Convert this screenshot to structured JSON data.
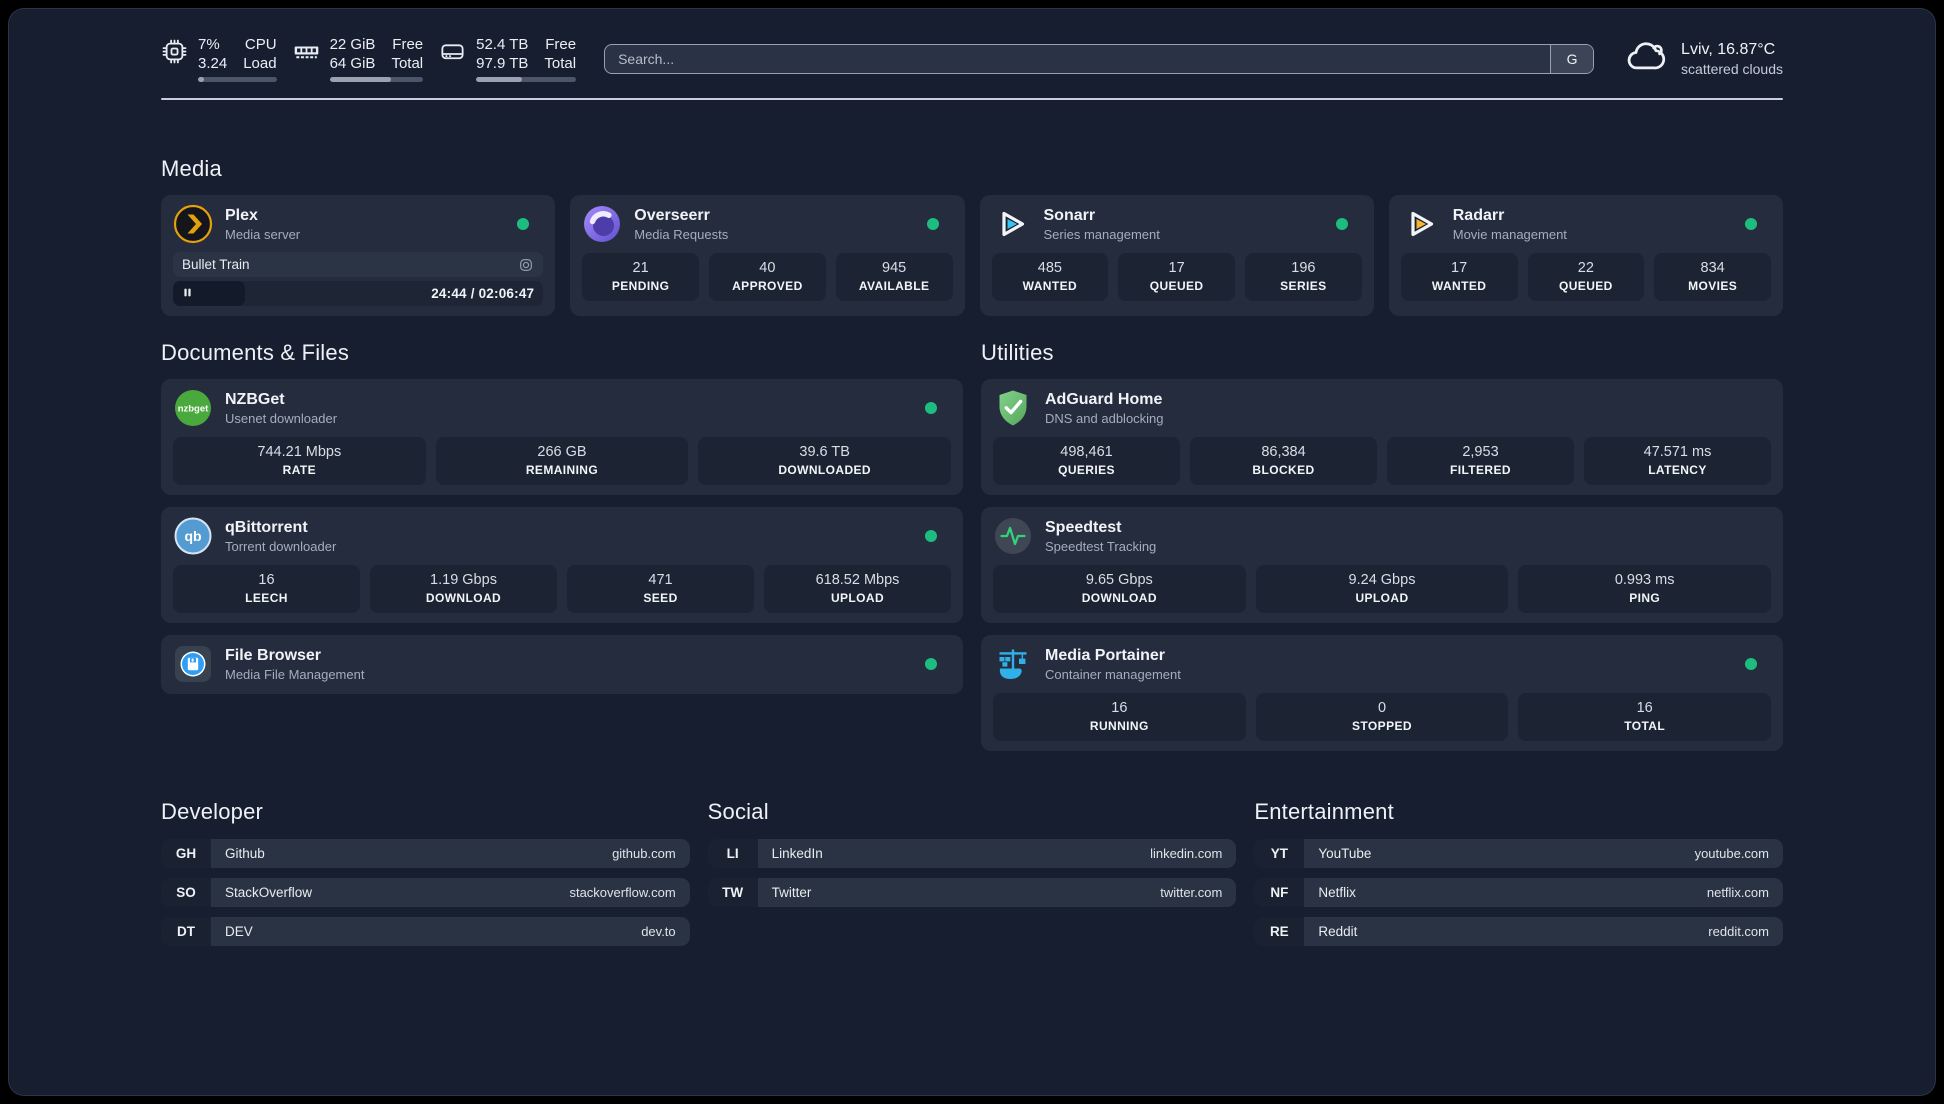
{
  "header": {
    "system_metrics": [
      {
        "icon": "cpu-icon",
        "values": [
          "7%",
          "3.24"
        ],
        "labels": [
          "CPU",
          "Load"
        ],
        "progress_pct": 7
      },
      {
        "icon": "ram-icon",
        "values": [
          "22 GiB",
          "64 GiB"
        ],
        "labels": [
          "Free",
          "Total"
        ],
        "progress_pct": 66
      },
      {
        "icon": "disk-icon",
        "values": [
          "52.4 TB",
          "97.9 TB"
        ],
        "labels": [
          "Free",
          "Total"
        ],
        "progress_pct": 46
      }
    ],
    "search": {
      "placeholder": "Search...",
      "provider_label": "G"
    },
    "weather": {
      "icon": "cloud-icon",
      "location_temp": "Lviv, 16.87°C",
      "condition": "scattered clouds"
    }
  },
  "sections": {
    "media": {
      "title": "Media",
      "apps": [
        {
          "name": "Plex",
          "subtitle": "Media server",
          "icon": "plex-icon",
          "online": true,
          "player": {
            "title": "Bullet Train",
            "time": "24:44 / 02:06:47",
            "progress_pct": 19.5
          }
        },
        {
          "name": "Overseerr",
          "subtitle": "Media Requests",
          "icon": "overseerr-icon",
          "online": true,
          "stats": [
            {
              "value": "21",
              "label": "PENDING"
            },
            {
              "value": "40",
              "label": "APPROVED"
            },
            {
              "value": "945",
              "label": "AVAILABLE"
            }
          ]
        },
        {
          "name": "Sonarr",
          "subtitle": "Series management",
          "icon": "sonarr-icon",
          "online": true,
          "stats": [
            {
              "value": "485",
              "label": "WANTED"
            },
            {
              "value": "17",
              "label": "QUEUED"
            },
            {
              "value": "196",
              "label": "SERIES"
            }
          ]
        },
        {
          "name": "Radarr",
          "subtitle": "Movie management",
          "icon": "radarr-icon",
          "online": true,
          "stats": [
            {
              "value": "17",
              "label": "WANTED"
            },
            {
              "value": "22",
              "label": "QUEUED"
            },
            {
              "value": "834",
              "label": "MOVIES"
            }
          ]
        }
      ]
    },
    "documents": {
      "title": "Documents & Files",
      "apps": [
        {
          "name": "NZBGet",
          "subtitle": "Usenet downloader",
          "icon": "nzbget-icon",
          "online": true,
          "stats": [
            {
              "value": "744.21 Mbps",
              "label": "RATE"
            },
            {
              "value": "266 GB",
              "label": "REMAINING"
            },
            {
              "value": "39.6 TB",
              "label": "DOWNLOADED"
            }
          ]
        },
        {
          "name": "qBittorrent",
          "subtitle": "Torrent downloader",
          "icon": "qbittorrent-icon",
          "online": true,
          "stats": [
            {
              "value": "16",
              "label": "LEECH"
            },
            {
              "value": "1.19 Gbps",
              "label": "DOWNLOAD"
            },
            {
              "value": "471",
              "label": "SEED"
            },
            {
              "value": "618.52 Mbps",
              "label": "UPLOAD"
            }
          ]
        },
        {
          "name": "File Browser",
          "subtitle": "Media File Management",
          "icon": "filebrowser-icon",
          "online": true
        }
      ]
    },
    "utilities": {
      "title": "Utilities",
      "apps": [
        {
          "name": "AdGuard Home",
          "subtitle": "DNS and adblocking",
          "icon": "adguard-icon",
          "online": false,
          "stats": [
            {
              "value": "498,461",
              "label": "QUERIES"
            },
            {
              "value": "86,384",
              "label": "BLOCKED"
            },
            {
              "value": "2,953",
              "label": "FILTERED"
            },
            {
              "value": "47.571 ms",
              "label": "LATENCY"
            }
          ]
        },
        {
          "name": "Speedtest",
          "subtitle": "Speedtest Tracking",
          "icon": "speedtest-icon",
          "online": false,
          "stats": [
            {
              "value": "9.65 Gbps",
              "label": "DOWNLOAD"
            },
            {
              "value": "9.24 Gbps",
              "label": "UPLOAD"
            },
            {
              "value": "0.993 ms",
              "label": "PING"
            }
          ]
        },
        {
          "name": "Media Portainer",
          "subtitle": "Container management",
          "icon": "portainer-icon",
          "online": true,
          "stats": [
            {
              "value": "16",
              "label": "RUNNING"
            },
            {
              "value": "0",
              "label": "STOPPED"
            },
            {
              "value": "16",
              "label": "TOTAL"
            }
          ]
        }
      ]
    },
    "bookmarks": [
      {
        "title": "Developer",
        "links": [
          {
            "abbr": "GH",
            "name": "Github",
            "url": "github.com"
          },
          {
            "abbr": "SO",
            "name": "StackOverflow",
            "url": "stackoverflow.com"
          },
          {
            "abbr": "DT",
            "name": "DEV",
            "url": "dev.to"
          }
        ]
      },
      {
        "title": "Social",
        "links": [
          {
            "abbr": "LI",
            "name": "LinkedIn",
            "url": "linkedin.com"
          },
          {
            "abbr": "TW",
            "name": "Twitter",
            "url": "twitter.com"
          }
        ]
      },
      {
        "title": "Entertainment",
        "links": [
          {
            "abbr": "YT",
            "name": "YouTube",
            "url": "youtube.com"
          },
          {
            "abbr": "NF",
            "name": "Netflix",
            "url": "netflix.com"
          },
          {
            "abbr": "RE",
            "name": "Reddit",
            "url": "reddit.com"
          }
        ]
      }
    ]
  },
  "colors": {
    "status_online": "#1dbd80",
    "plex_accent": "#e5a00d",
    "page_bg": "#171e2f",
    "card_bg": "#242c3d"
  }
}
